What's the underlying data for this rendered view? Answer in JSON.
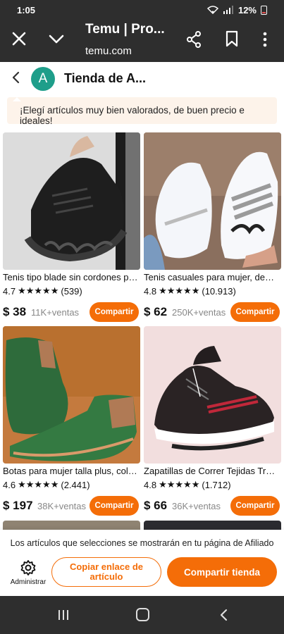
{
  "status_bar": {
    "time": "1:05",
    "battery": "12%"
  },
  "custom_tab": {
    "title": "Temu | Pro...",
    "url": "temu.com"
  },
  "store": {
    "avatar_letter": "A",
    "name": "Tienda de A..."
  },
  "promo_text": "¡Elegí artículos muy bien valorados, de buen precio e ideales!",
  "products": [
    {
      "name": "Tenis tipo blade sin cordones para...",
      "rating": "4.7",
      "stars": "★★★★★",
      "reviews": "(539)",
      "price": "$ 38",
      "sales": "11K+ventas",
      "share_label": "Compartir",
      "image": "black-slip-on-sneaker"
    },
    {
      "name": "Tenis casuales para mujer, deportivos...",
      "rating": "4.8",
      "stars": "★★★★★",
      "reviews": "(10.913)",
      "price": "$ 62",
      "sales": "250K+ventas",
      "share_label": "Compartir",
      "image": "white-casual-sneakers"
    },
    {
      "name": "Botas para mujer talla plus, color verde",
      "rating": "4.6",
      "stars": "★★★★★",
      "reviews": "(2.441)",
      "price": "$ 197",
      "sales": "38K+ventas",
      "share_label": "Compartir",
      "image": "green-leather-boots"
    },
    {
      "name": "Zapatillas de Correr Tejidas Transpirables",
      "rating": "4.8",
      "stars": "★★★★★",
      "reviews": "(1.712)",
      "price": "$ 66",
      "sales": "36K+ventas",
      "share_label": "Compartir",
      "image": "black-red-running-shoes"
    }
  ],
  "bottom": {
    "info": "Los artículos que selecciones se mostrarán en tu página de Afiliado",
    "admin_label": "Administrar",
    "copy_button": "Copiar enlace de artículo",
    "store_button": "Compartir tienda"
  },
  "colors": {
    "accent": "#f46d08",
    "header_bg": "#2e2e2e",
    "avatar_bg": "#1e9e8a",
    "promo_bg": "#fdf3ea"
  }
}
